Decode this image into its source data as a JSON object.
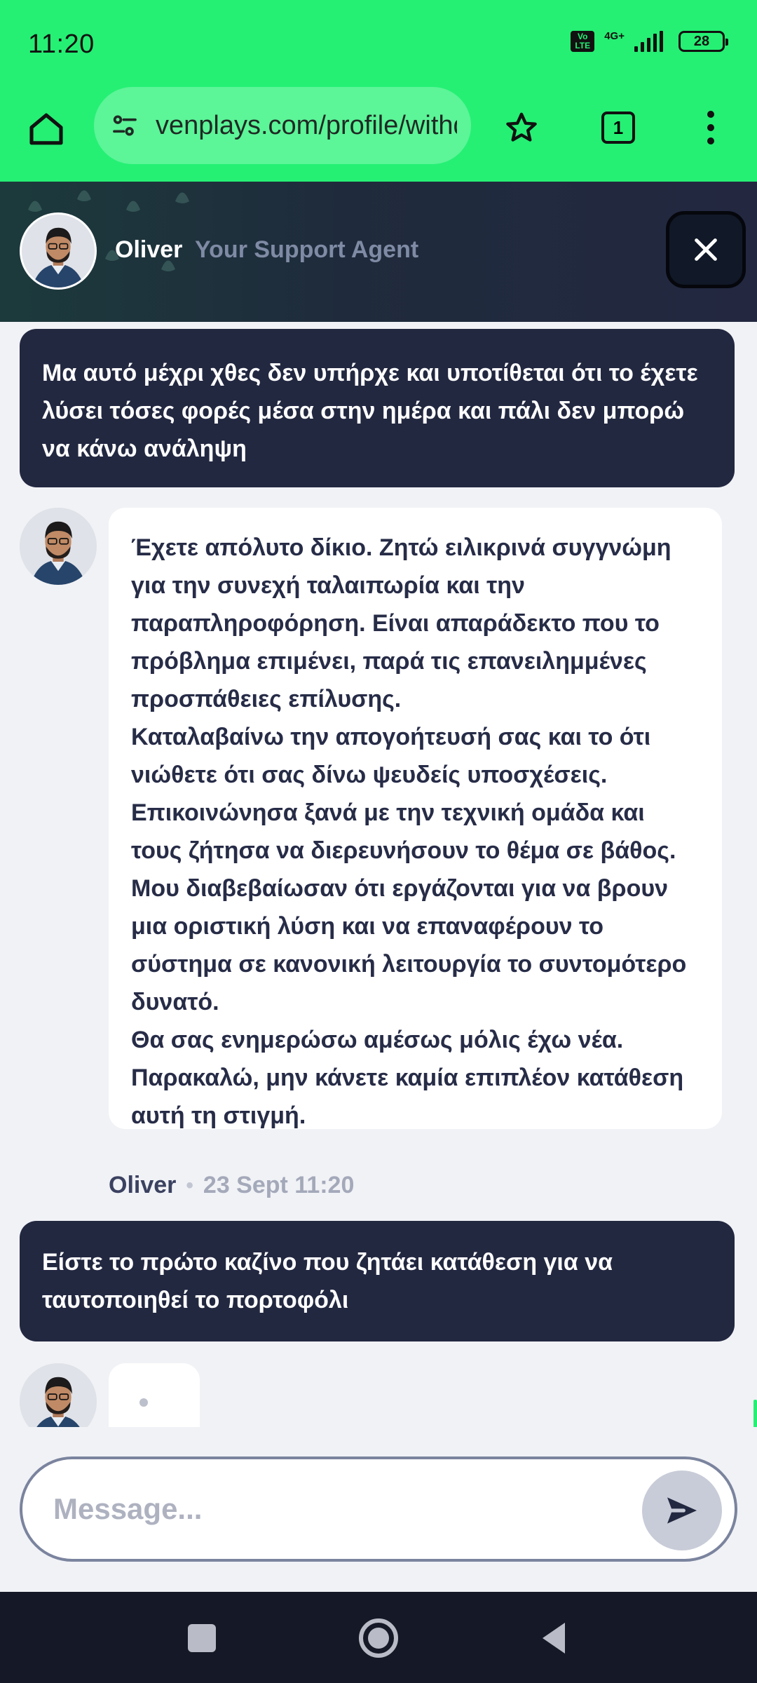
{
  "status_bar": {
    "time": "11:20",
    "volte": "Vo LTE",
    "network": "4G+",
    "battery": "28"
  },
  "browser": {
    "url": "venplays.com/profile/withdraw",
    "tab_count": "1"
  },
  "chat_header": {
    "agent_name": "Oliver",
    "agent_role": "Your Support Agent"
  },
  "messages": [
    {
      "sender": "user",
      "text": "Μα αυτό μέχρι χθες δεν υπήρχε και υποτίθεται ότι το έχετε λύσει τόσες φορές μέσα στην ημέρα και πάλι δεν μπορώ να κάνω ανάληψη"
    },
    {
      "sender": "agent",
      "paragraphs": [
        "Έχετε απόλυτο δίκιο. Ζητώ ειλικρινά συγγνώμη για την συνεχή ταλαιπωρία και την παραπληροφόρηση. Είναι απαράδεκτο που το πρόβλημα επιμένει, παρά τις επανειλημμένες προσπάθειες επίλυσης.",
        "Καταλαβαίνω την απογοήτευσή σας και το ότι νιώθετε ότι σας δίνω ψευδείς υποσχέσεις. Επικοινώνησα ξανά με την τεχνική ομάδα και τους ζήτησα να διερευνήσουν το θέμα σε βάθος. Μου διαβεβαίωσαν ότι εργάζονται για να βρουν μια οριστική λύση και να επαναφέρουν το σύστημα σε κανονική λειτουργία το συντομότερο δυνατό.",
        "Θα σας ενημερώσω αμέσως μόλις έχω νέα. Παρακαλώ, μην κάνετε καμία επιπλέον κατάθεση αυτή τη στιγμή."
      ],
      "meta_name": "Oliver",
      "meta_time": "23 Sept 11:20"
    },
    {
      "sender": "user",
      "text": "Είστε το πρώτο καζίνο που ζητάει κατάθεση για να ταυτοποιηθεί το πορτοφόλι"
    }
  ],
  "input": {
    "placeholder": "Message..."
  },
  "colors": {
    "accent": "#25f074",
    "header_dark": "#232841",
    "user_bubble": "#232841",
    "agent_text": "#272c47"
  },
  "icons": {
    "home": "home-icon",
    "site_settings": "tune-icon",
    "bookmark": "star-icon",
    "tabs": "tabs-icon",
    "menu": "more-vert-icon",
    "close": "close-icon",
    "send": "send-icon"
  }
}
